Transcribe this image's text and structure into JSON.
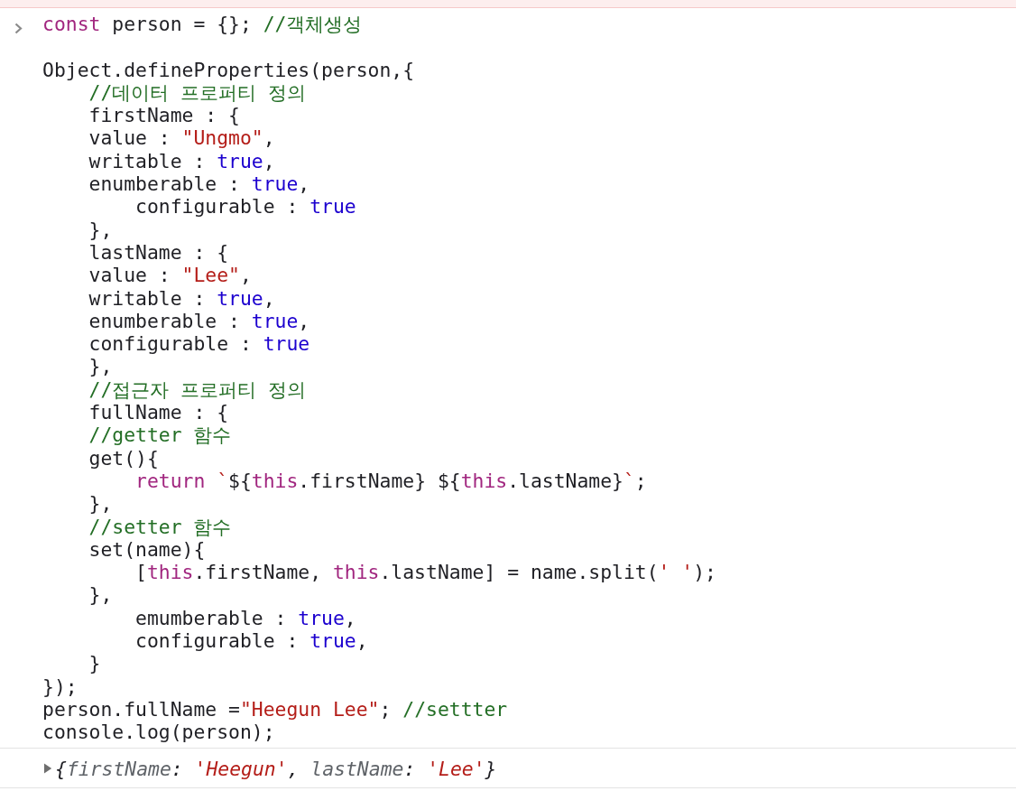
{
  "previous_message": {
    "kind": "error"
  },
  "input": {
    "lines": [
      {
        "kind": "code",
        "tokens": [
          {
            "kind": "keyword",
            "text": "const"
          },
          {
            "kind": "plain",
            "text": " person = {}; "
          },
          {
            "kind": "comment",
            "text": "//객체생성"
          }
        ]
      },
      {
        "kind": "blank"
      },
      {
        "kind": "code",
        "tokens": [
          {
            "kind": "plain",
            "text": "Object.defineProperties(person,{"
          }
        ]
      },
      {
        "kind": "code",
        "tokens": [
          {
            "kind": "comment",
            "text": "    //데이터 프로퍼티 정의"
          }
        ]
      },
      {
        "kind": "code",
        "tokens": [
          {
            "kind": "plain",
            "text": "    firstName : {"
          }
        ]
      },
      {
        "kind": "code",
        "tokens": [
          {
            "kind": "plain",
            "text": "    value : "
          },
          {
            "kind": "string",
            "text": "\"Ungmo\""
          },
          {
            "kind": "plain",
            "text": ","
          }
        ]
      },
      {
        "kind": "code",
        "tokens": [
          {
            "kind": "plain",
            "text": "    writable : "
          },
          {
            "kind": "literal",
            "text": "true"
          },
          {
            "kind": "plain",
            "text": ","
          }
        ]
      },
      {
        "kind": "code",
        "tokens": [
          {
            "kind": "plain",
            "text": "    enumberable : "
          },
          {
            "kind": "literal",
            "text": "true"
          },
          {
            "kind": "plain",
            "text": ","
          }
        ]
      },
      {
        "kind": "code",
        "tokens": [
          {
            "kind": "plain",
            "text": "        configurable : "
          },
          {
            "kind": "literal",
            "text": "true"
          }
        ]
      },
      {
        "kind": "code",
        "tokens": [
          {
            "kind": "plain",
            "text": "    },"
          }
        ]
      },
      {
        "kind": "code",
        "tokens": [
          {
            "kind": "plain",
            "text": "    lastName : {"
          }
        ]
      },
      {
        "kind": "code",
        "tokens": [
          {
            "kind": "plain",
            "text": "    value : "
          },
          {
            "kind": "string",
            "text": "\"Lee\""
          },
          {
            "kind": "plain",
            "text": ","
          }
        ]
      },
      {
        "kind": "code",
        "tokens": [
          {
            "kind": "plain",
            "text": "    writable : "
          },
          {
            "kind": "literal",
            "text": "true"
          },
          {
            "kind": "plain",
            "text": ","
          }
        ]
      },
      {
        "kind": "code",
        "tokens": [
          {
            "kind": "plain",
            "text": "    enumberable : "
          },
          {
            "kind": "literal",
            "text": "true"
          },
          {
            "kind": "plain",
            "text": ","
          }
        ]
      },
      {
        "kind": "code",
        "tokens": [
          {
            "kind": "plain",
            "text": "    configurable : "
          },
          {
            "kind": "literal",
            "text": "true"
          }
        ]
      },
      {
        "kind": "code",
        "tokens": [
          {
            "kind": "plain",
            "text": "    },"
          }
        ]
      },
      {
        "kind": "code",
        "tokens": [
          {
            "kind": "comment",
            "text": "    //접근자 프로퍼티 정의"
          }
        ]
      },
      {
        "kind": "code",
        "tokens": [
          {
            "kind": "plain",
            "text": "    fullName : {"
          }
        ]
      },
      {
        "kind": "code",
        "tokens": [
          {
            "kind": "comment",
            "text": "    //getter 함수"
          }
        ]
      },
      {
        "kind": "code",
        "tokens": [
          {
            "kind": "plain",
            "text": "    get(){"
          }
        ]
      },
      {
        "kind": "code",
        "tokens": [
          {
            "kind": "keyword",
            "text": "        return "
          },
          {
            "kind": "string",
            "text": "`"
          },
          {
            "kind": "plain",
            "text": "${"
          },
          {
            "kind": "keyword",
            "text": "this"
          },
          {
            "kind": "plain",
            "text": ".firstName} ${"
          },
          {
            "kind": "keyword",
            "text": "this"
          },
          {
            "kind": "plain",
            "text": ".lastName}"
          },
          {
            "kind": "string",
            "text": "`"
          },
          {
            "kind": "plain",
            "text": ";"
          }
        ]
      },
      {
        "kind": "code",
        "tokens": [
          {
            "kind": "plain",
            "text": "    },"
          }
        ]
      },
      {
        "kind": "code",
        "tokens": [
          {
            "kind": "comment",
            "text": "    //setter 함수"
          }
        ]
      },
      {
        "kind": "code",
        "tokens": [
          {
            "kind": "plain",
            "text": "    set(name){"
          }
        ]
      },
      {
        "kind": "code",
        "tokens": [
          {
            "kind": "plain",
            "text": "        ["
          },
          {
            "kind": "keyword",
            "text": "this"
          },
          {
            "kind": "plain",
            "text": ".firstName, "
          },
          {
            "kind": "keyword",
            "text": "this"
          },
          {
            "kind": "plain",
            "text": ".lastName] = name.split("
          },
          {
            "kind": "string",
            "text": "' '"
          },
          {
            "kind": "plain",
            "text": ");"
          }
        ]
      },
      {
        "kind": "code",
        "tokens": [
          {
            "kind": "plain",
            "text": "    },"
          }
        ]
      },
      {
        "kind": "code",
        "tokens": [
          {
            "kind": "plain",
            "text": "        emumberable : "
          },
          {
            "kind": "literal",
            "text": "true"
          },
          {
            "kind": "plain",
            "text": ","
          }
        ]
      },
      {
        "kind": "code",
        "tokens": [
          {
            "kind": "plain",
            "text": "        configurable : "
          },
          {
            "kind": "literal",
            "text": "true"
          },
          {
            "kind": "plain",
            "text": ","
          }
        ]
      },
      {
        "kind": "code",
        "tokens": [
          {
            "kind": "plain",
            "text": "    }"
          }
        ]
      },
      {
        "kind": "code",
        "tokens": [
          {
            "kind": "plain",
            "text": "});"
          }
        ]
      },
      {
        "kind": "code",
        "tokens": [
          {
            "kind": "plain",
            "text": "person.fullName ="
          },
          {
            "kind": "string",
            "text": "\"Heegun Lee\""
          },
          {
            "kind": "plain",
            "text": "; "
          },
          {
            "kind": "comment",
            "text": "//settter"
          }
        ]
      },
      {
        "kind": "code",
        "tokens": [
          {
            "kind": "plain",
            "text": "console.log(person);"
          }
        ]
      }
    ]
  },
  "output": {
    "expanded": false,
    "tokens": [
      {
        "kind": "punct",
        "text": "{"
      },
      {
        "kind": "key",
        "text": "firstName"
      },
      {
        "kind": "punct",
        "text": ": "
      },
      {
        "kind": "string",
        "text": "'Heegun'"
      },
      {
        "kind": "punct",
        "text": ", "
      },
      {
        "kind": "key",
        "text": "lastName"
      },
      {
        "kind": "punct",
        "text": ": "
      },
      {
        "kind": "string",
        "text": "'Lee'"
      },
      {
        "kind": "punct",
        "text": "}"
      }
    ]
  }
}
